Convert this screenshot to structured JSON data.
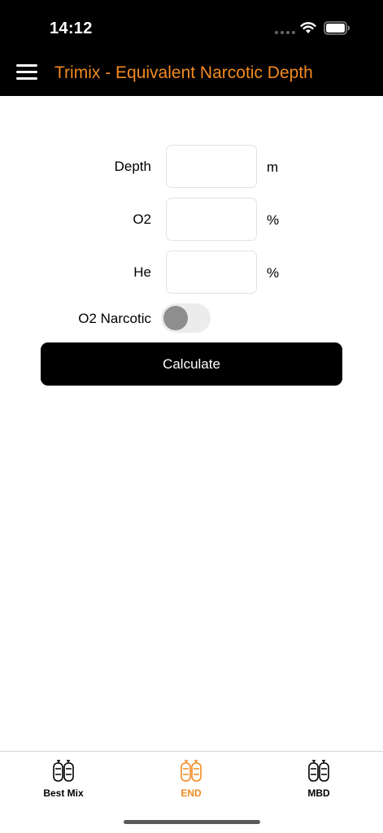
{
  "status": {
    "time": "14:12"
  },
  "header": {
    "title": "Trimix - Equivalent Narcotic Depth"
  },
  "form": {
    "depth_label": "Depth",
    "depth_unit": "m",
    "depth_value": "",
    "o2_label": "O2",
    "o2_unit": "%",
    "o2_value": "",
    "he_label": "He",
    "he_unit": "%",
    "he_value": "",
    "o2_narcotic_label": "O2 Narcotic",
    "o2_narcotic_on": false,
    "calculate_label": "Calculate"
  },
  "tabs": [
    {
      "label": "Best Mix",
      "icon": "tank-icon",
      "active": false
    },
    {
      "label": "END",
      "icon": "tank-icon",
      "active": true
    },
    {
      "label": "MBD",
      "icon": "tank-icon",
      "active": false
    }
  ],
  "colors": {
    "accent": "#f28a22",
    "inactive_tab": "#000000",
    "header_bg": "#000000"
  }
}
